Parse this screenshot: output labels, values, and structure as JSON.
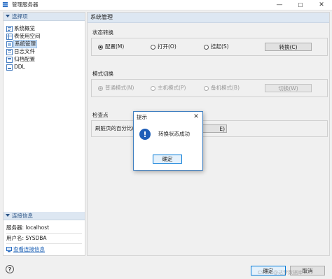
{
  "window": {
    "title": "管理服务器",
    "controls": {
      "minimize": "—",
      "maximize": "☐",
      "close": "✕"
    }
  },
  "left_panel": {
    "select_section": {
      "title": "选择项",
      "items": [
        {
          "label": "系统概览",
          "icon": "overview-icon"
        },
        {
          "label": "表使用空间",
          "icon": "table-space-icon"
        },
        {
          "label": "系统管理",
          "icon": "system-manage-icon",
          "selected": true
        },
        {
          "label": "日志文件",
          "icon": "log-file-icon"
        },
        {
          "label": "归档配置",
          "icon": "archive-config-icon"
        },
        {
          "label": "DDL",
          "icon": "ddl-icon"
        }
      ]
    },
    "connection_section": {
      "title": "连接信息",
      "server": "服务器: localhost",
      "user": "用户名: SYSDBA",
      "link": "查看连接信息"
    }
  },
  "main_panel": {
    "title": "系统管理",
    "state_group": {
      "title": "状态转换",
      "options": [
        "配置(M)",
        "打开(O)",
        "挂起(S)"
      ],
      "selected_index": 0,
      "button": "转换(C)"
    },
    "mode_group": {
      "title": "模式切换",
      "options": [
        "普通模式(N)",
        "主机模式(P)",
        "备机模式(B)"
      ],
      "selected_index": 0,
      "button": "切换(W)",
      "disabled": true
    },
    "checkpoint_group": {
      "title": "检查点",
      "label": "刷脏页的百分比(",
      "button_tail": "E)"
    }
  },
  "dialog": {
    "title": "提示",
    "close": "✕",
    "message": "转换状态成功",
    "ok": "确定"
  },
  "footer": {
    "help": "?",
    "ok": "确定",
    "cancel": "取消",
    "watermark": "CSDN @达梦数据库"
  },
  "colors": {
    "accent": "#1e5eb8",
    "header_bg": "#dde7f2",
    "link": "#1a5fb4"
  }
}
